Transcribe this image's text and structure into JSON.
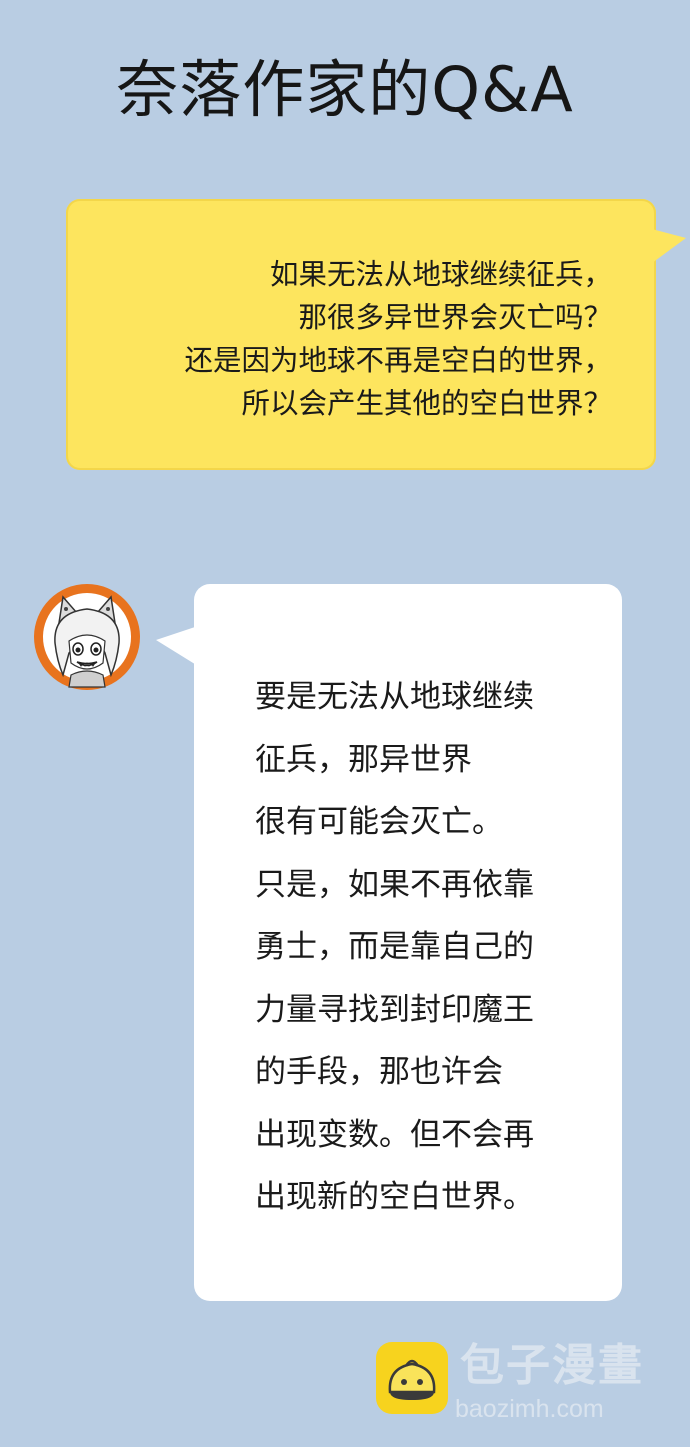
{
  "title": "奈落作家的Q&A",
  "question": {
    "text": "如果无法从地球继续征兵，\n那很多异世界会灭亡吗？\n还是因为地球不再是空白的世界，\n所以会产生其他的空白世界？",
    "color": "#fde55e"
  },
  "answer": {
    "text": "要是无法从地球继续\n征兵，那异世界\n很有可能会灭亡。\n只是，如果不再依靠\n勇士，而是靠自己的\n力量寻找到封印魔王\n的手段，那也许会\n出现变数。但不会再\n出现新的空白世界。",
    "avatar_icon": "author-avatar-icon",
    "avatar_ring_color": "#e8731e"
  },
  "watermark": {
    "brand": "包子漫畫",
    "url": "baozimh.com",
    "icon": "bun-logo-icon"
  },
  "colors": {
    "background": "#b9cde3",
    "answer_bubble": "#ffffff"
  }
}
